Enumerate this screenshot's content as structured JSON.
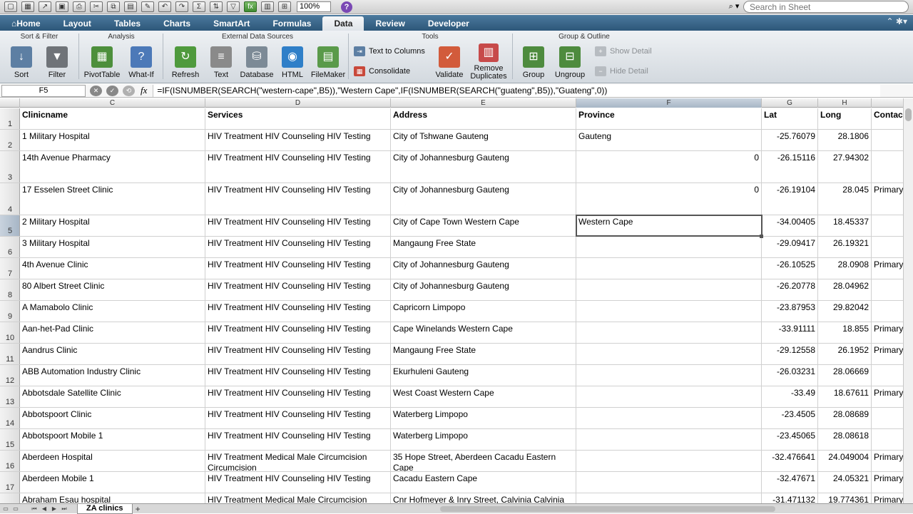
{
  "toolbar": {
    "zoom": "100%",
    "search_placeholder": "Search in Sheet"
  },
  "tabs": [
    {
      "label": "Home"
    },
    {
      "label": "Layout"
    },
    {
      "label": "Tables"
    },
    {
      "label": "Charts"
    },
    {
      "label": "SmartArt"
    },
    {
      "label": "Formulas"
    },
    {
      "label": "Data"
    },
    {
      "label": "Review"
    },
    {
      "label": "Developer"
    }
  ],
  "ribbon": {
    "groups": {
      "sort_filter": "Sort & Filter",
      "analysis": "Analysis",
      "external_data": "External Data Sources",
      "tools": "Tools",
      "group_outline": "Group & Outline"
    },
    "buttons": {
      "sort": "Sort",
      "filter": "Filter",
      "pivottable": "PivotTable",
      "whatif": "What-If",
      "refresh": "Refresh",
      "text": "Text",
      "database": "Database",
      "html": "HTML",
      "filemaker": "FileMaker",
      "text_to_columns": "Text to Columns",
      "consolidate": "Consolidate",
      "validate": "Validate",
      "remove_duplicates_1": "Remove",
      "remove_duplicates_2": "Duplicates",
      "group": "Group",
      "ungroup": "Ungroup",
      "show_detail": "Show Detail",
      "hide_detail": "Hide Detail"
    }
  },
  "formula_bar": {
    "name_box": "F5",
    "fx": "fx",
    "formula": "=IF(ISNUMBER(SEARCH(\"western-cape\",B5)),\"Western Cape\",IF(ISNUMBER(SEARCH(\"guateng\",B5)),\"Guateng\",0))"
  },
  "columns": [
    {
      "letter": "C"
    },
    {
      "letter": "D"
    },
    {
      "letter": "E"
    },
    {
      "letter": "F"
    },
    {
      "letter": "G"
    },
    {
      "letter": "H"
    },
    {
      "letter": ""
    }
  ],
  "rows": [
    {
      "num": "1",
      "cells": [
        "Clinicname",
        "Services",
        "Address",
        "Province",
        "Lat",
        "Long",
        "Contac"
      ]
    },
    {
      "num": "2",
      "cells": [
        "1 Military Hospital",
        "HIV Treatment HIV Counseling HIV Testing",
        "City of Tshwane Gauteng",
        "Gauteng",
        "-25.76079",
        "28.1806",
        ""
      ]
    },
    {
      "num": "3",
      "cells": [
        "14th Avenue Pharmacy",
        "HIV Treatment HIV Counseling HIV Testing",
        "City of Johannesburg Gauteng",
        "0",
        "-26.15116",
        "27.94302",
        ""
      ]
    },
    {
      "num": "4",
      "cells": [
        "17 Esselen Street Clinic",
        "HIV Treatment HIV Counseling HIV Testing",
        "City of Johannesburg Gauteng",
        "0",
        "-26.19104",
        "28.045",
        "Primary"
      ]
    },
    {
      "num": "5",
      "cells": [
        "2 Military Hospital",
        "HIV Treatment HIV Counseling HIV Testing",
        "City of Cape Town Western Cape",
        "Western Cape",
        "-34.00405",
        "18.45337",
        ""
      ]
    },
    {
      "num": "6",
      "cells": [
        "3 Military Hospital",
        "HIV Treatment HIV Counseling HIV Testing",
        "Mangaung Free State",
        "",
        "-29.09417",
        "26.19321",
        ""
      ]
    },
    {
      "num": "7",
      "cells": [
        "4th Avenue Clinic",
        "HIV Treatment HIV Counseling HIV Testing",
        "City of Johannesburg Gauteng",
        "",
        "-26.10525",
        "28.0908",
        "Primary"
      ]
    },
    {
      "num": "8",
      "cells": [
        "80 Albert Street Clinic",
        "HIV Treatment HIV Counseling HIV Testing",
        "City of Johannesburg Gauteng",
        "",
        "-26.20778",
        "28.04962",
        ""
      ]
    },
    {
      "num": "9",
      "cells": [
        "A Mamabolo Clinic",
        "HIV Treatment HIV Counseling HIV Testing",
        "Capricorn Limpopo",
        "",
        "-23.87953",
        "29.82042",
        ""
      ]
    },
    {
      "num": "10",
      "cells": [
        "Aan-het-Pad Clinic",
        "HIV Treatment HIV Counseling HIV Testing",
        "Cape Winelands Western Cape",
        "",
        "-33.91111",
        "18.855",
        "Primary"
      ]
    },
    {
      "num": "11",
      "cells": [
        "Aandrus Clinic",
        "HIV Treatment HIV Counseling HIV Testing",
        "Mangaung Free State",
        "",
        "-29.12558",
        "26.1952",
        "Primary"
      ]
    },
    {
      "num": "12",
      "cells": [
        "ABB Automation Industry Clinic",
        "HIV Treatment HIV Counseling HIV Testing",
        "Ekurhuleni Gauteng",
        "",
        "-26.03231",
        "28.06669",
        ""
      ]
    },
    {
      "num": "13",
      "cells": [
        "Abbotsdale Satellite Clinic",
        "HIV Treatment HIV Counseling HIV Testing",
        "West Coast Western Cape",
        "",
        "-33.49",
        "18.67611",
        "Primary"
      ]
    },
    {
      "num": "14",
      "cells": [
        "Abbotspoort Clinic",
        "HIV Treatment HIV Counseling HIV Testing",
        "Waterberg Limpopo",
        "",
        "-23.4505",
        "28.08689",
        ""
      ]
    },
    {
      "num": "15",
      "cells": [
        "Abbotspoort Mobile 1",
        "HIV Treatment HIV Counseling HIV Testing",
        "Waterberg Limpopo",
        "",
        "-23.45065",
        "28.08618",
        ""
      ]
    },
    {
      "num": "16",
      "cells": [
        "Aberdeen Hospital",
        "HIV Treatment Medical Male Circumcision Circumcision",
        "35 Hope Street, Aberdeen Cacadu Eastern Cape",
        "",
        "-32.476641",
        "24.049004",
        "Primary"
      ]
    },
    {
      "num": "17",
      "cells": [
        "Aberdeen Mobile 1",
        "HIV Treatment HIV Counseling HIV Testing",
        "Cacadu Eastern Cape",
        "",
        "-32.47671",
        "24.05321",
        "Primary"
      ]
    },
    {
      "num": "18",
      "cells": [
        "Abraham Esau hospital",
        "HIV Treatment Medical Male Circumcision",
        "Cnr Hofmeyer & Inry Street, Calvinia Calvinia",
        "",
        "-31.471132",
        "19.774361",
        "Primary"
      ]
    }
  ],
  "sheet_tab": "ZA clinics"
}
